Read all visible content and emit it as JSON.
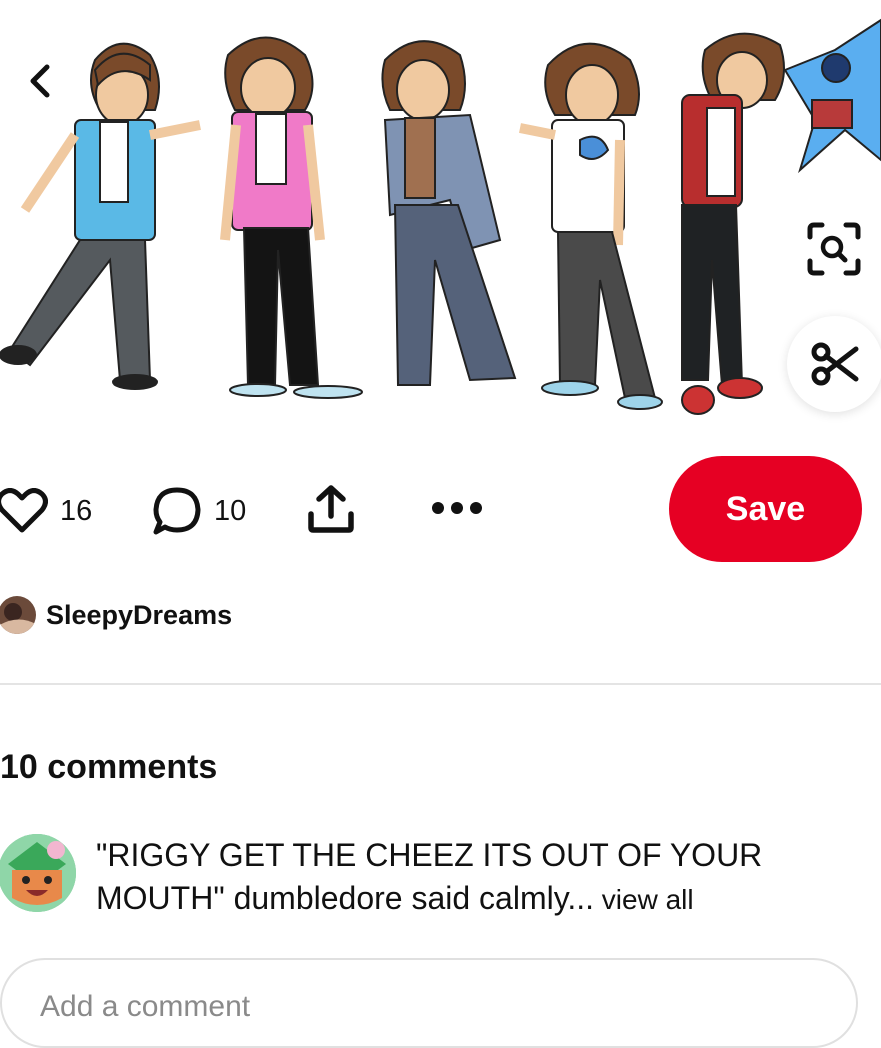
{
  "pin": {
    "image_alt": "",
    "likes": "16",
    "comments_count": "10",
    "save_label": "Save"
  },
  "icons": {
    "back": "chevron-left-icon",
    "visual_search": "lens-icon",
    "cut": "scissors-icon",
    "like": "heart-icon",
    "comment": "comment-bubble-icon",
    "share": "share-icon",
    "more": "more-icon"
  },
  "creator": {
    "name": "SleepyDreams"
  },
  "comments": {
    "title": "10 comments",
    "items": [
      {
        "text": "\"RIGGY GET THE CHEEZ ITS OUT OF YOUR MOUTH\" dumbledore said calmly",
        "ellipsis": "...",
        "view_all": " view all"
      }
    ]
  },
  "add_comment": {
    "placeholder": "Add a comment"
  },
  "colors": {
    "save": "#e60023",
    "divider": "#e4e4e4"
  }
}
